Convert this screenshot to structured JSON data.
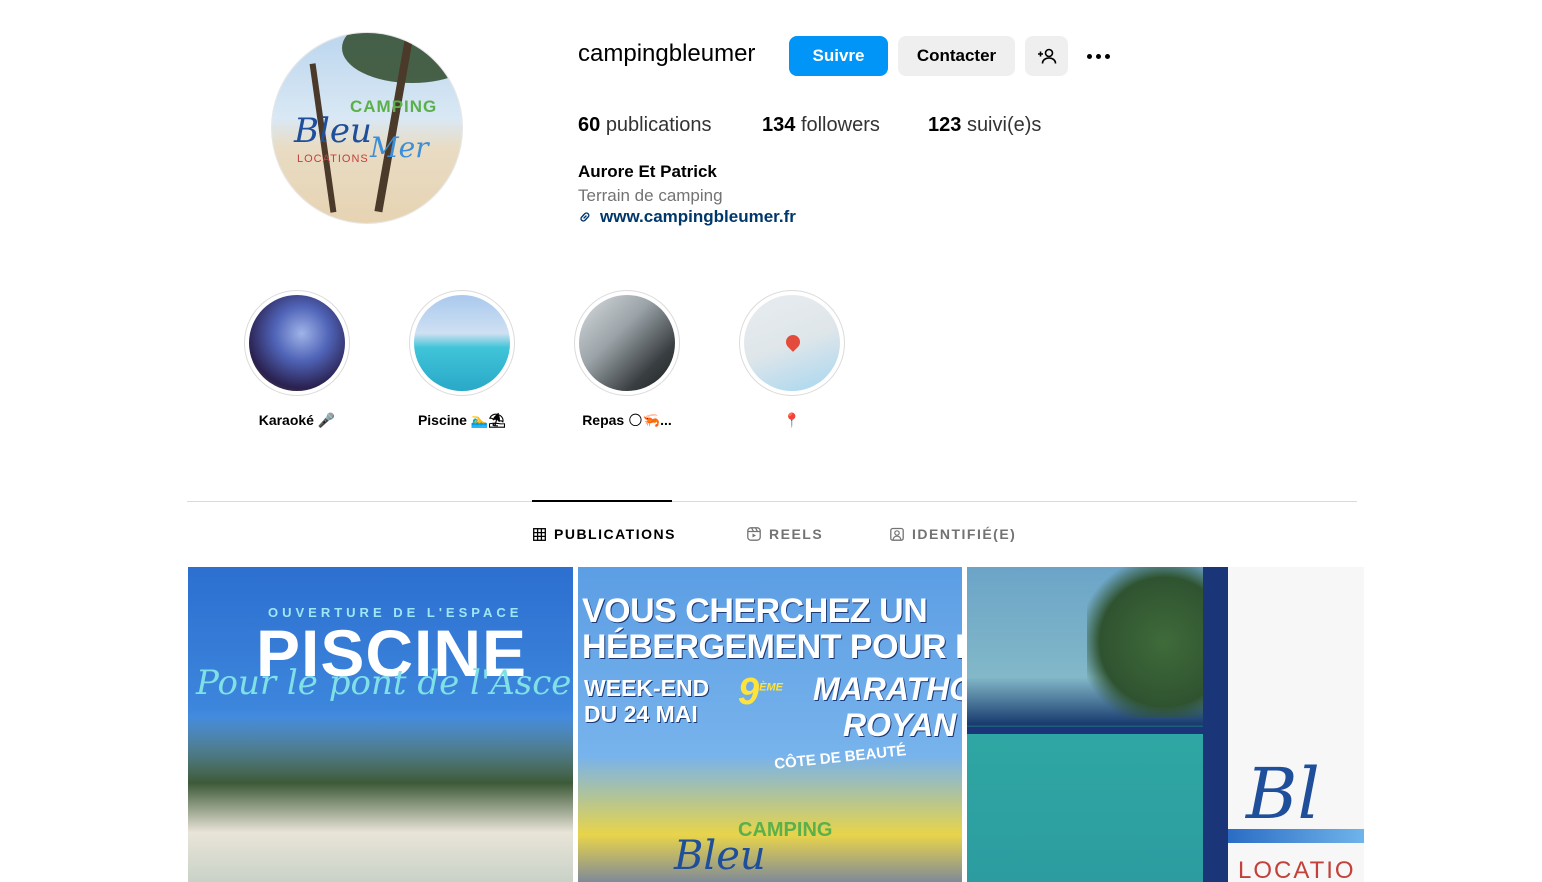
{
  "profile": {
    "username": "campingbleumer",
    "follow_label": "Suivre",
    "contact_label": "Contacter",
    "stats": {
      "publications_count": "60",
      "publications_label": "publications",
      "followers_count": "134",
      "followers_label": "followers",
      "following_count": "123",
      "following_label": "suivi(e)s"
    },
    "full_name": "Aurore Et Patrick",
    "category": "Terrain de camping",
    "website": "www.campingbleumer.fr",
    "avatar_logo": {
      "camping": "CAMPING",
      "bleu": "Bleu",
      "mer": "Mer",
      "locations": "LOCATIONS"
    }
  },
  "highlights": [
    {
      "label": "Karaoké 🎤"
    },
    {
      "label": "Piscine 🏊‍♂️⛱"
    },
    {
      "label": "Repas 🌕🦐..."
    },
    {
      "label": "📍"
    }
  ],
  "tabs": [
    {
      "label": "PUBLICATIONS",
      "active": true
    },
    {
      "label": "REELS",
      "active": false
    },
    {
      "label": "IDENTIFIÉ(E)",
      "active": false
    }
  ],
  "posts": {
    "p1": {
      "kicker": "OUVERTURE DE L'ESPACE",
      "title": "PISCINE",
      "script": "Pour le pont de l'Ascension"
    },
    "p2": {
      "head_line1": "VOUS CHERCHEZ UN",
      "head_line2": "HÉBERGEMENT POUR LE",
      "week_line1": "WEEK-END",
      "week_line2": "DU 24 MAI",
      "number": "9",
      "ordinal": "ÈME",
      "marathon": "MARATHON",
      "royan": "ROYAN",
      "cote": "CÔTE DE BEAUTÉ",
      "camping": "CAMPING",
      "bleu": "Bleu"
    },
    "p4": {
      "bleu": "Bl",
      "locations": "LOCATIO"
    }
  },
  "colors": {
    "accent": "#0095f6",
    "secondary_button": "#efefef",
    "link": "#00376b",
    "muted": "#737373",
    "divider": "#dbdbdb"
  }
}
